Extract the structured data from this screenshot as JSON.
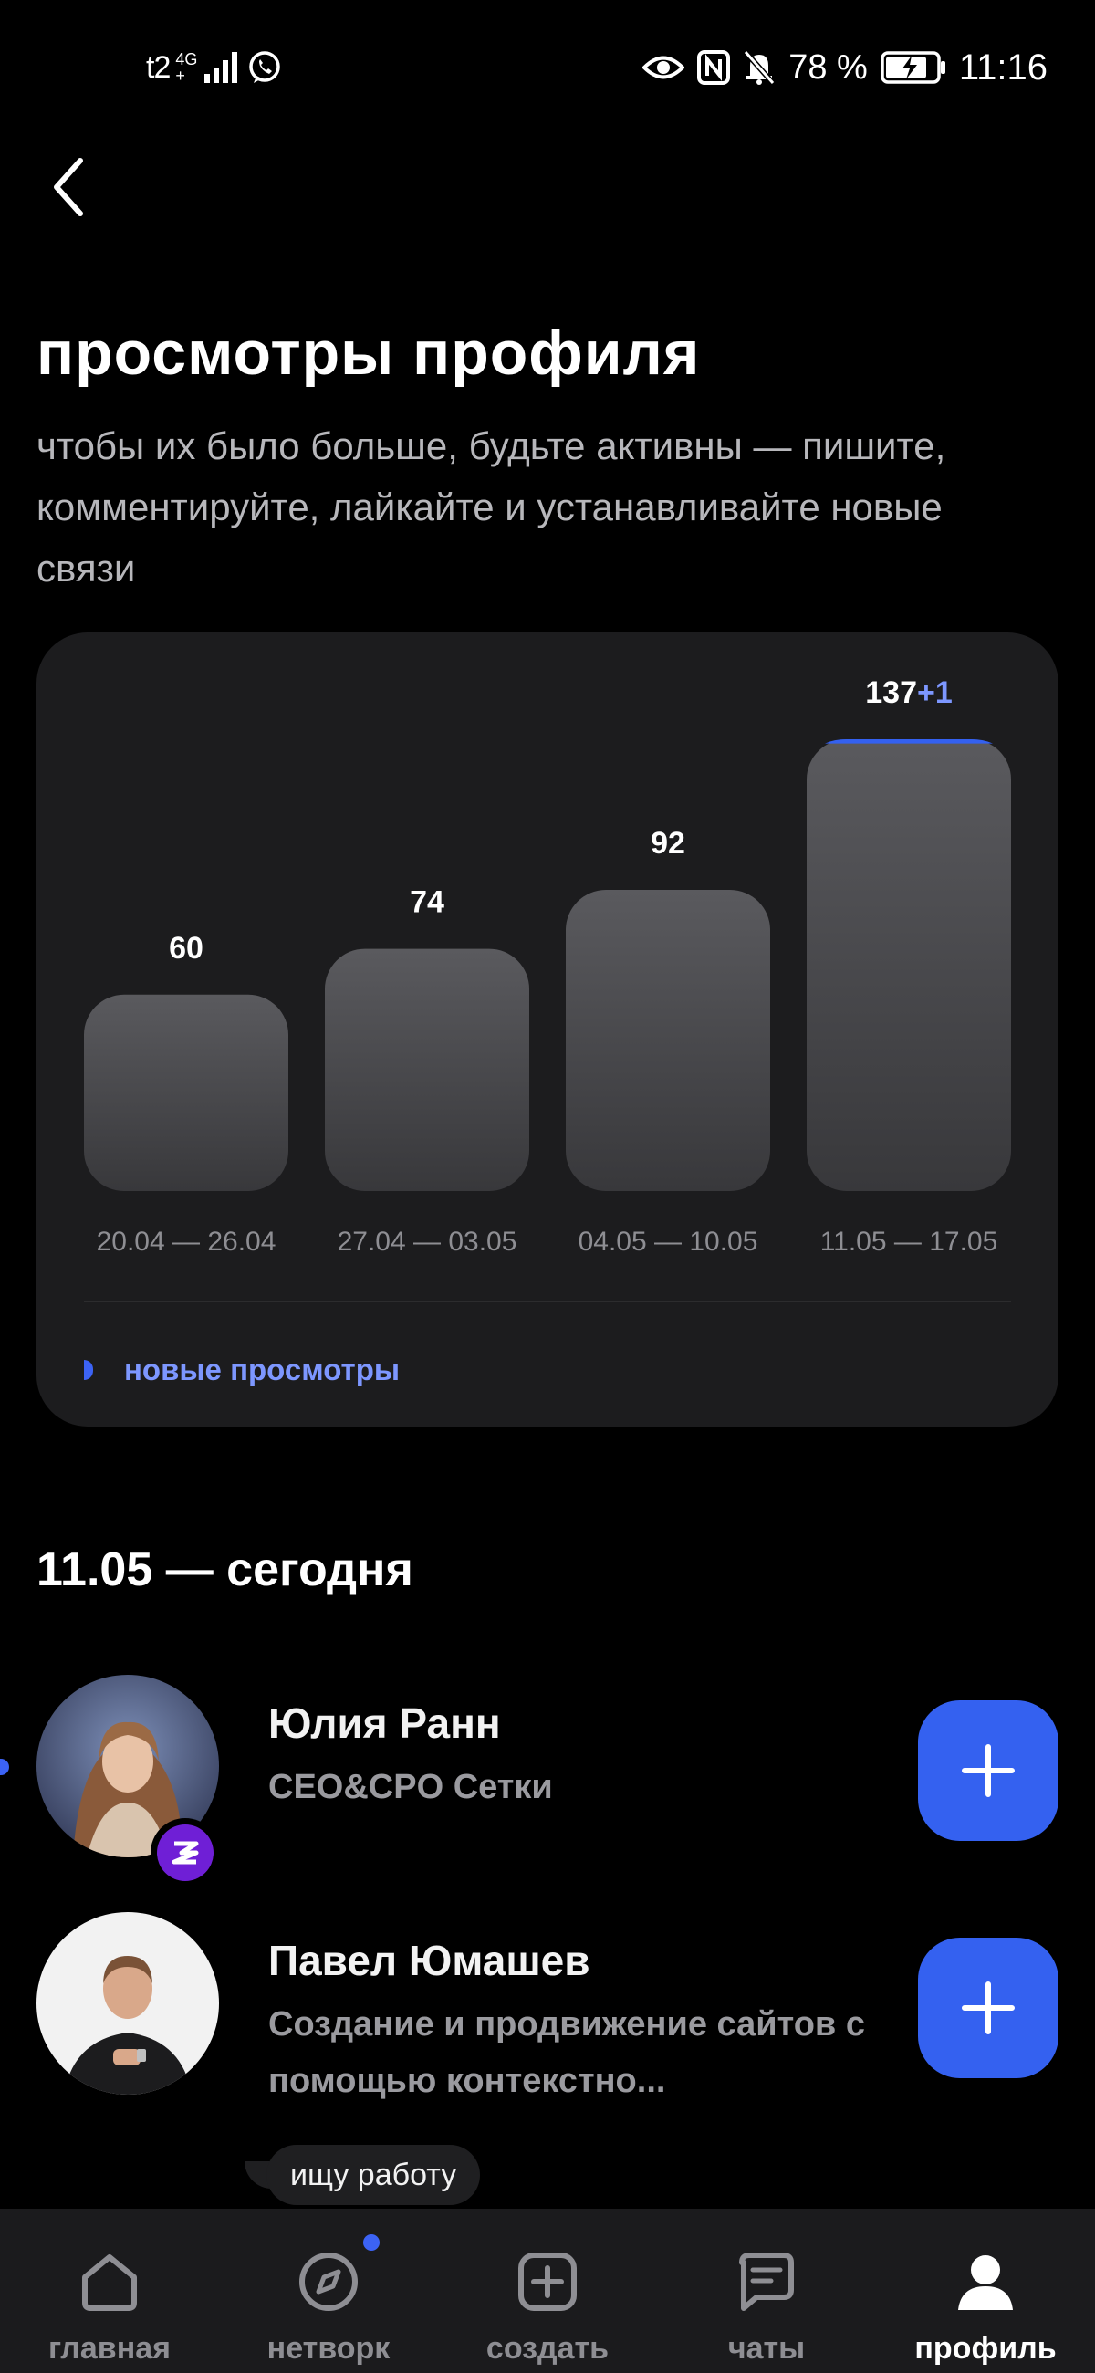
{
  "status_bar": {
    "network": "t2",
    "network_gen_top": "4G",
    "network_gen_bottom": "+",
    "battery_percent": "78 %",
    "time": "11:16"
  },
  "header": {
    "title": "просмотры профиля",
    "subtitle": "чтобы их было больше, будьте активны — пишите, комментируйте, лайкайте и устанавливайте новые связи"
  },
  "chart_data": {
    "type": "bar",
    "categories": [
      "20.04 — 26.04",
      "27.04 — 03.05",
      "04.05 — 10.05",
      "11.05 — 17.05"
    ],
    "series": [
      {
        "values": [
          60,
          74,
          92,
          137
        ]
      },
      {
        "name": "новые просмотры",
        "values": [
          0,
          0,
          0,
          1
        ]
      }
    ],
    "value_labels": [
      "60",
      "74",
      "92",
      "137"
    ],
    "new_labels": [
      "",
      "",
      "",
      "+1"
    ],
    "legend_position": "bottom-left",
    "grid": false
  },
  "legend": {
    "label": "новые просмотры"
  },
  "colors": {
    "accent": "#3461f0",
    "new_views": "#7d97ff",
    "bar_top": "#5a5a5e",
    "bar_bottom": "#38383b",
    "card": "#1c1c1e"
  },
  "section": {
    "title": "11.05 — сегодня"
  },
  "people": [
    {
      "name": "Юлия Ранн",
      "description": "CEO&CPO Сетки",
      "avatar_icon": "woman-avatar",
      "badge_icon": "setka-logo-badge"
    },
    {
      "name": "Павел Юмашев",
      "description": "Создание и продвижение сайтов с помощью контекстно...",
      "avatar_icon": "man-avatar",
      "tooltip": "ищу работу"
    }
  ],
  "nav": {
    "items": [
      {
        "label": "главная",
        "icon": "home-icon"
      },
      {
        "label": "нетворк",
        "icon": "compass-icon"
      },
      {
        "label": "создать",
        "icon": "plus-square-icon"
      },
      {
        "label": "чаты",
        "icon": "chat-icon"
      },
      {
        "label": "профиль",
        "icon": "user-icon"
      }
    ],
    "active": "профиль"
  }
}
